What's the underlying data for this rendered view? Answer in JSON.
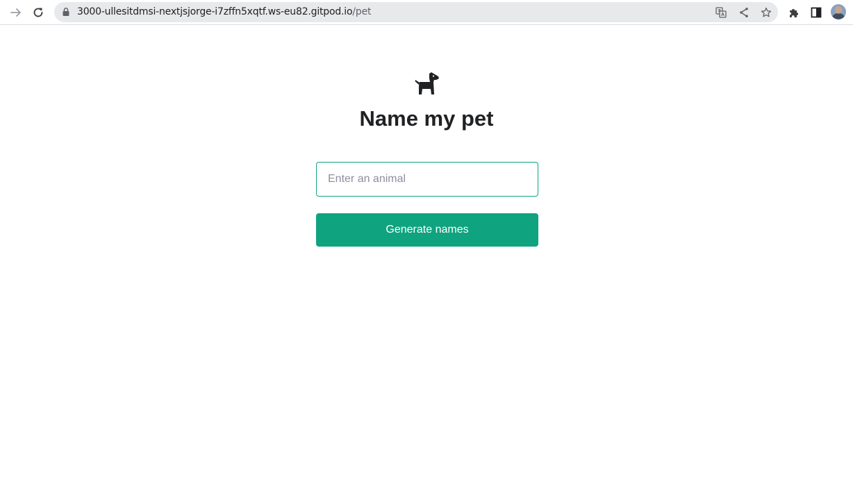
{
  "browser": {
    "url_host": "3000-ullesitdmsi-nextjsjorge-i7zffn5xqtf.ws-eu82.gitpod.io",
    "url_path": "/pet",
    "icons": {
      "back": "arrow-right-icon",
      "reload": "reload-icon",
      "lock": "lock-icon",
      "translate": "translate-icon",
      "share": "share-icon",
      "bookmark": "star-icon",
      "extensions": "puzzle-icon",
      "side_panel": "side-panel-icon",
      "profile": "avatar"
    }
  },
  "page": {
    "logo_icon": "dog-icon",
    "title": "Name my pet",
    "animal_input": {
      "value": "",
      "placeholder": "Enter an animal"
    },
    "submit_label": "Generate names"
  },
  "colors": {
    "accent": "#10a37f",
    "text": "#202123",
    "placeholder": "#8e8ea0",
    "omnibox_bg": "#e8e9eb"
  }
}
